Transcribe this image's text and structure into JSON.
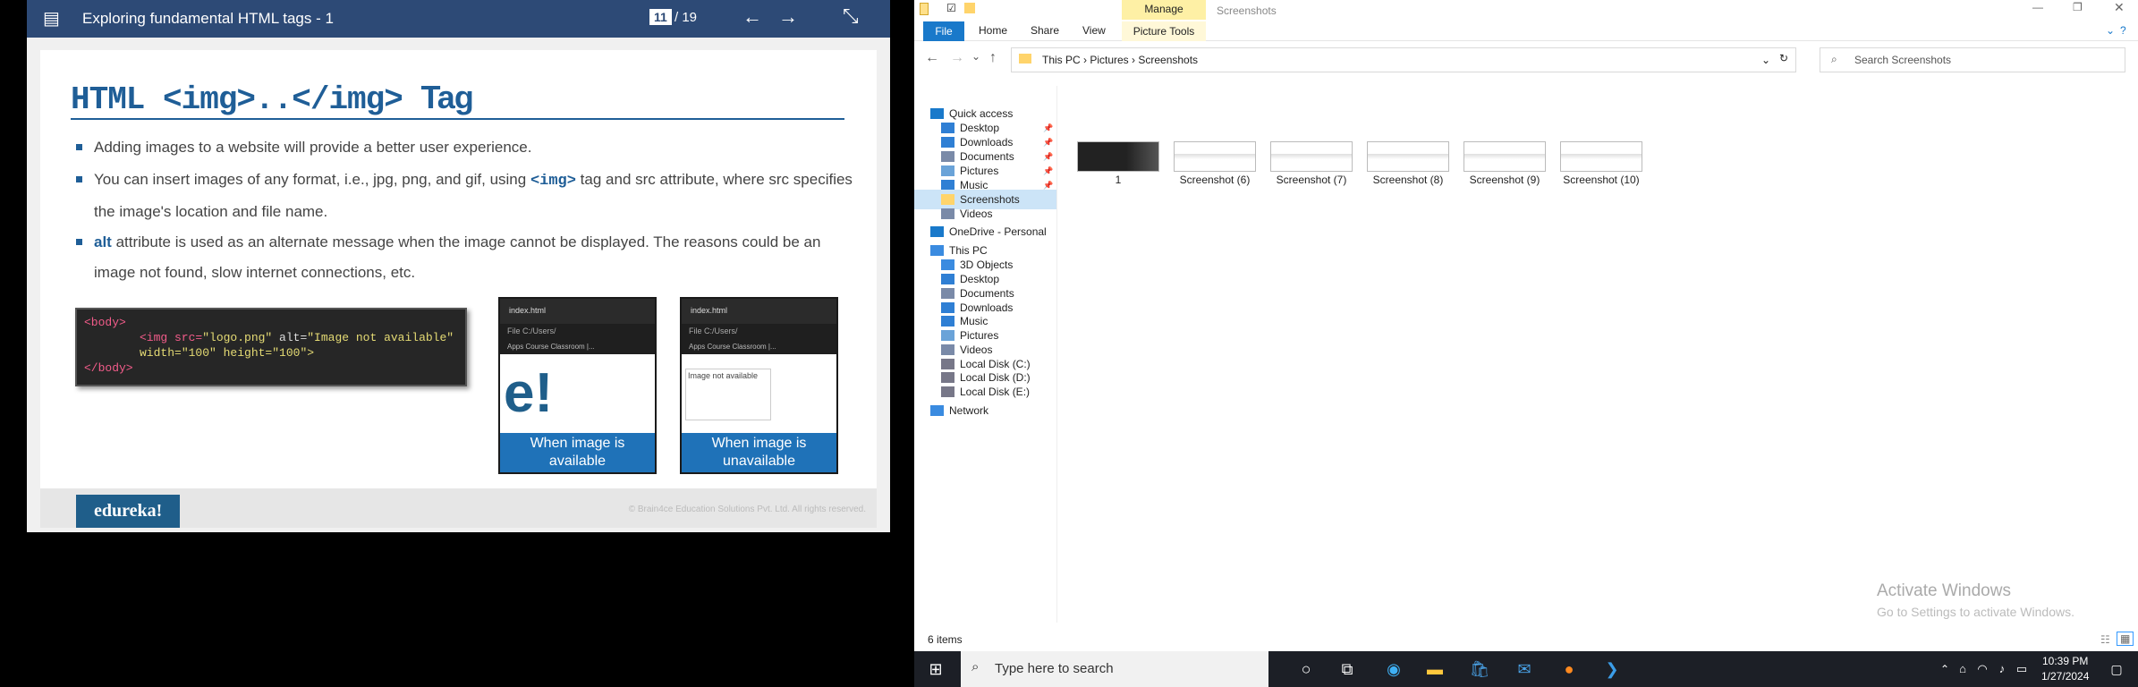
{
  "viewer": {
    "title": "Exploring fundamental HTML tags - 1",
    "page": "11",
    "total": "/ 19"
  },
  "slide": {
    "title_code": "HTML <img>..</img>",
    "title_word": "Tag",
    "b1": "Adding images to a website will provide a better user experience.",
    "b2a": "You can insert images of any format, i.e., jpg, png, and gif, using ",
    "b2code": "<img>",
    "b2b": " tag and src attribute, where src specifies the image's location and file name.",
    "b3bold": "alt",
    "b3": " attribute is used as an alternate message when the image cannot be displayed. The reasons could be an image not found, slow internet connections, etc.",
    "code": {
      "l1": "<body>",
      "l2a": "<img src=",
      "l2b": "\"logo.png\"",
      "l2c": " alt=",
      "l2d": "\"Image not available\"",
      "l3a": "width=",
      "l3b": "\"100\"",
      "l3c": " height=",
      "l3d": "\"100\">",
      "l4": "</body>"
    },
    "br1": {
      "tab": "index.html",
      "addr": "File  C:/Users/",
      "bm": "Apps   Course Classroom |...",
      "img": "e!",
      "cap": "When image is available"
    },
    "br2": {
      "tab": "index.html",
      "addr": "File  C:/Users/",
      "bm": "Apps   Course Classroom |...",
      "alt": "Image not available",
      "cap": "When image is unavailable"
    },
    "logo": "edureka!",
    "copyright": "© Brain4ce Education Solutions Pvt. Ltd. All rights reserved."
  },
  "explorer": {
    "manage": "Manage",
    "title": "Screenshots",
    "file": "File",
    "home": "Home",
    "share": "Share",
    "view": "View",
    "ptools": "Picture Tools",
    "path": "This PC  ›  Pictures  ›  Screenshots",
    "search": "Search Screenshots",
    "side": [
      "Quick access",
      "Desktop",
      "Downloads",
      "Documents",
      "Pictures",
      "Music",
      "Screenshots",
      "Videos",
      "OneDrive - Personal",
      "This PC",
      "3D Objects",
      "Desktop",
      "Documents",
      "Downloads",
      "Music",
      "Pictures",
      "Videos",
      "Local Disk (C:)",
      "Local Disk (D:)",
      "Local Disk (E:)",
      "Network"
    ],
    "files": [
      "1",
      "Screenshot (6)",
      "Screenshot (7)",
      "Screenshot (8)",
      "Screenshot (9)",
      "Screenshot (10)"
    ],
    "status": "6 items",
    "act1": "Activate Windows",
    "act2": "Go to Settings to activate Windows."
  },
  "taskbar": {
    "search": "Type here to search",
    "time": "10:39 PM",
    "date": "1/27/2024"
  }
}
